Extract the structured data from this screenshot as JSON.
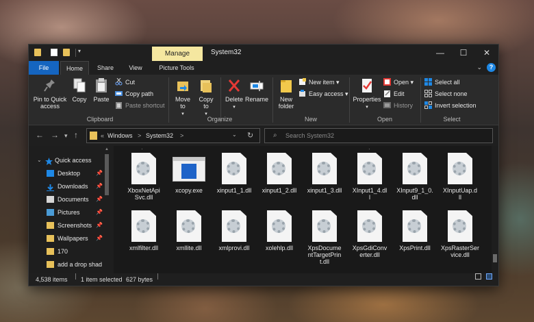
{
  "window": {
    "title": "System32",
    "context_tab": "Manage",
    "controls": {
      "minimize": "—",
      "maximize": "☐",
      "close": "✕"
    }
  },
  "ribbon_tabs": [
    "File",
    "Home",
    "Share",
    "View",
    "Picture Tools"
  ],
  "help": "?",
  "ribbon": {
    "clipboard": {
      "label": "Clipboard",
      "pin": "Pin to Quick access",
      "copy": "Copy",
      "paste": "Paste",
      "cut": "Cut",
      "copy_path": "Copy path",
      "paste_shortcut": "Paste shortcut"
    },
    "organize": {
      "label": "Organize",
      "move_to": "Move to",
      "copy_to": "Copy to",
      "delete": "Delete",
      "rename": "Rename"
    },
    "new": {
      "label": "New",
      "new_folder": "New folder",
      "new_item": "New item",
      "easy_access": "Easy access"
    },
    "open": {
      "label": "Open",
      "properties": "Properties",
      "open": "Open",
      "edit": "Edit",
      "history": "History"
    },
    "select": {
      "label": "Select",
      "select_all": "Select all",
      "select_none": "Select none",
      "invert": "Invert selection"
    }
  },
  "address": {
    "crumbs": [
      "«",
      "Windows",
      ">",
      "System32",
      ">"
    ],
    "search_placeholder": "Search System32"
  },
  "nav": [
    {
      "label": "Quick access",
      "pinned": false
    },
    {
      "label": "Desktop",
      "pinned": true
    },
    {
      "label": "Downloads",
      "pinned": true
    },
    {
      "label": "Documents",
      "pinned": true
    },
    {
      "label": "Pictures",
      "pinned": true
    },
    {
      "label": "Screenshots",
      "pinned": true
    },
    {
      "label": "Wallpapers",
      "pinned": true
    },
    {
      "label": "170",
      "pinned": false
    },
    {
      "label": "add a drop shad",
      "pinned": false
    }
  ],
  "files_row1": [
    {
      "name": "XboxNetApiSvc.dll",
      "line1": "XboxNetApi",
      "line2": "Svc.dll",
      "line3": ""
    },
    {
      "name": "xcopy.exe",
      "line1": "xcopy.exe",
      "line2": "",
      "line3": ""
    },
    {
      "name": "xinput1_1.dll",
      "line1": "xinput1_1.dll",
      "line2": "",
      "line3": ""
    },
    {
      "name": "xinput1_2.dll",
      "line1": "xinput1_2.dll",
      "line2": "",
      "line3": ""
    },
    {
      "name": "xinput1_3.dll",
      "line1": "xinput1_3.dll",
      "line2": "",
      "line3": ""
    },
    {
      "name": "XInput1_4.dll",
      "line1": "XInput1_4.dl",
      "line2": "l",
      "line3": ""
    },
    {
      "name": "XInput9_1_0.dll",
      "line1": "XInput9_1_0.",
      "line2": "dll",
      "line3": ""
    },
    {
      "name": "XInputUap.dll",
      "line1": "XInputUap.d",
      "line2": "ll",
      "line3": ""
    }
  ],
  "files_row2": [
    {
      "name": "xmlfilter.dll",
      "line1": "xmlfilter.dll",
      "line2": "",
      "line3": ""
    },
    {
      "name": "xmllite.dll",
      "line1": "xmllite.dll",
      "line2": "",
      "line3": ""
    },
    {
      "name": "xmlprovi.dll",
      "line1": "xmlprovi.dll",
      "line2": "",
      "line3": ""
    },
    {
      "name": "xolehlp.dll",
      "line1": "xolehlp.dll",
      "line2": "",
      "line3": ""
    },
    {
      "name": "XpsDocumentTargetPrint.dll",
      "line1": "XpsDocume",
      "line2": "ntTargetPrin",
      "line3": "t.dll"
    },
    {
      "name": "XpsGdiConverter.dll",
      "line1": "XpsGdiConv",
      "line2": "erter.dll",
      "line3": ""
    },
    {
      "name": "XpsPrint.dll",
      "line1": "XpsPrint.dll",
      "line2": "",
      "line3": ""
    },
    {
      "name": "XpsRasterService.dll",
      "line1": "XpsRasterSer",
      "line2": "vice.dll",
      "line3": ""
    }
  ],
  "status": {
    "item_count": "4,538 items",
    "selection": "1 item selected",
    "size": "627 bytes"
  },
  "colors": {
    "accent": "#1565c0",
    "manage_tab": "#f5e7a0",
    "window_bg": "#1e1e1e"
  }
}
